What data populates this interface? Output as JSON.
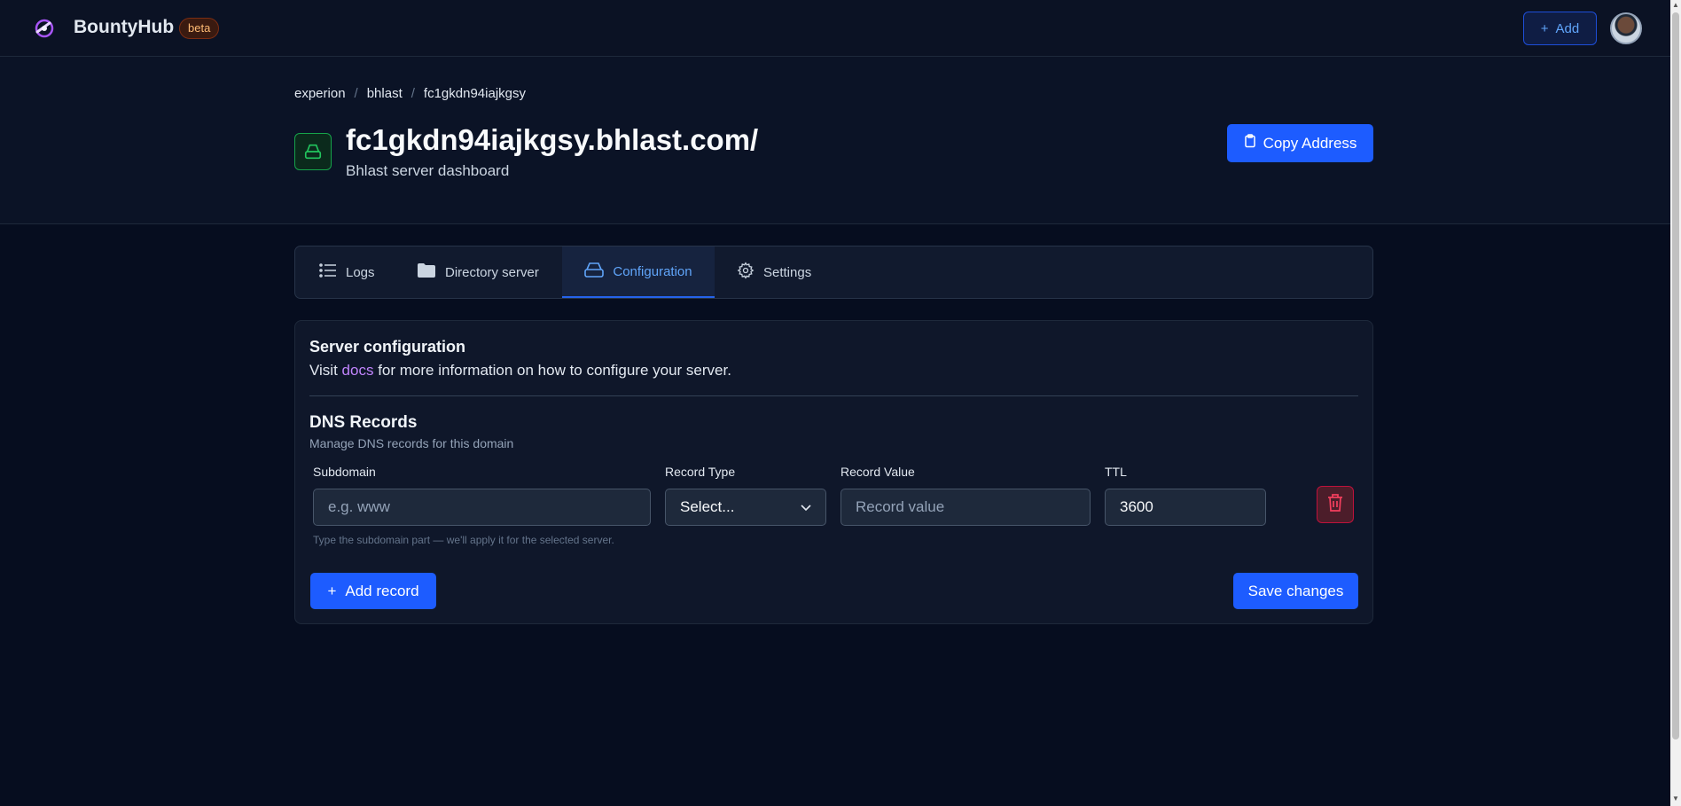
{
  "header": {
    "brand": "BountyHub",
    "badge": "beta",
    "add_label": "Add"
  },
  "breadcrumb": [
    "experion",
    "bhlast",
    "fc1gkdn94iajkgsy"
  ],
  "page": {
    "title": "fc1gkdn94iajkgsy.bhlast.com/",
    "subtitle": "Bhlast server dashboard",
    "copy_label": "Copy Address"
  },
  "tabs": [
    {
      "label": "Logs",
      "icon": "list-icon"
    },
    {
      "label": "Directory server",
      "icon": "folder-icon"
    },
    {
      "label": "Configuration",
      "icon": "server-icon",
      "active": true
    },
    {
      "label": "Settings",
      "icon": "gear-icon"
    }
  ],
  "config": {
    "title": "Server configuration",
    "desc_before": "Visit ",
    "desc_link": "docs",
    "desc_after": " for more information on how to configure your server."
  },
  "dns": {
    "title": "DNS Records",
    "desc": "Manage DNS records for this domain",
    "labels": {
      "subdomain": "Subdomain",
      "record_type": "Record Type",
      "record_value": "Record Value",
      "ttl": "TTL"
    },
    "subdomain_placeholder": "e.g. www",
    "record_type_value": "Select...",
    "record_value_placeholder": "Record value",
    "ttl_value": "3600",
    "hint": "Type the subdomain part — we'll apply it for the selected server.",
    "add_record_label": "Add record",
    "save_label": "Save changes"
  },
  "colors": {
    "accent": "#1d5cff",
    "link": "#c084fc",
    "active_tab": "#60a5fa",
    "danger": "#be123c"
  }
}
